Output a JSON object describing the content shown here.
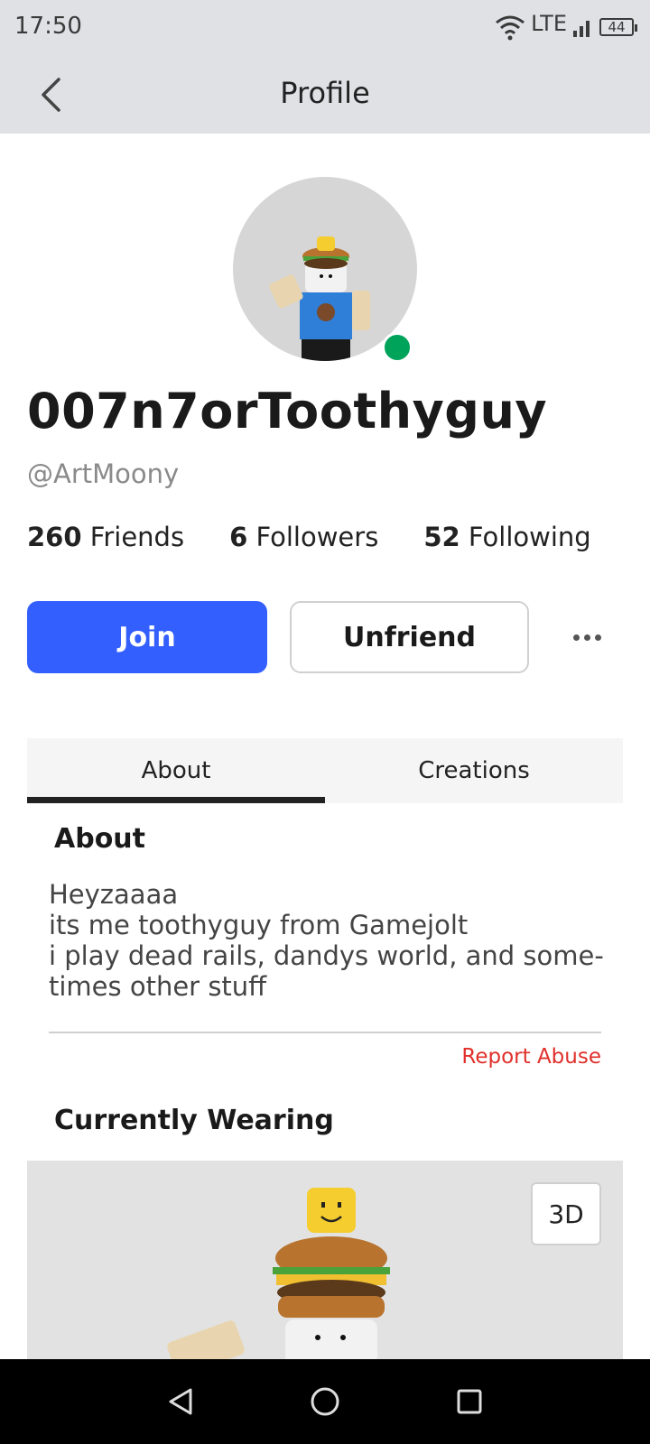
{
  "status_bar": {
    "time": "17:50",
    "network": "LTE",
    "battery": "44"
  },
  "header": {
    "title": "Profile"
  },
  "profile": {
    "display_name": "007n7orToothyguy",
    "username": "@ArtMoony",
    "stats": {
      "friends_count": "260",
      "friends_label": "Friends",
      "followers_count": "6",
      "followers_label": "Followers",
      "following_count": "52",
      "following_label": "Following"
    }
  },
  "actions": {
    "join_label": "Join",
    "unfriend_label": "Unfriend"
  },
  "tabs": [
    {
      "label": "About",
      "active": true
    },
    {
      "label": "Creations",
      "active": false
    }
  ],
  "about": {
    "title": "About",
    "lines": [
      "Heyzaaaa",
      "its me toothyguy from Gamejolt",
      "i play dead rails, dandys world, and some-",
      "times other stuff"
    ],
    "report_label": "Report Abuse"
  },
  "wearing": {
    "title": "Currently Wearing",
    "view_3d_label": "3D"
  },
  "colors": {
    "primary": "#335fff",
    "online": "#00a35a",
    "danger": "#e0302b"
  }
}
